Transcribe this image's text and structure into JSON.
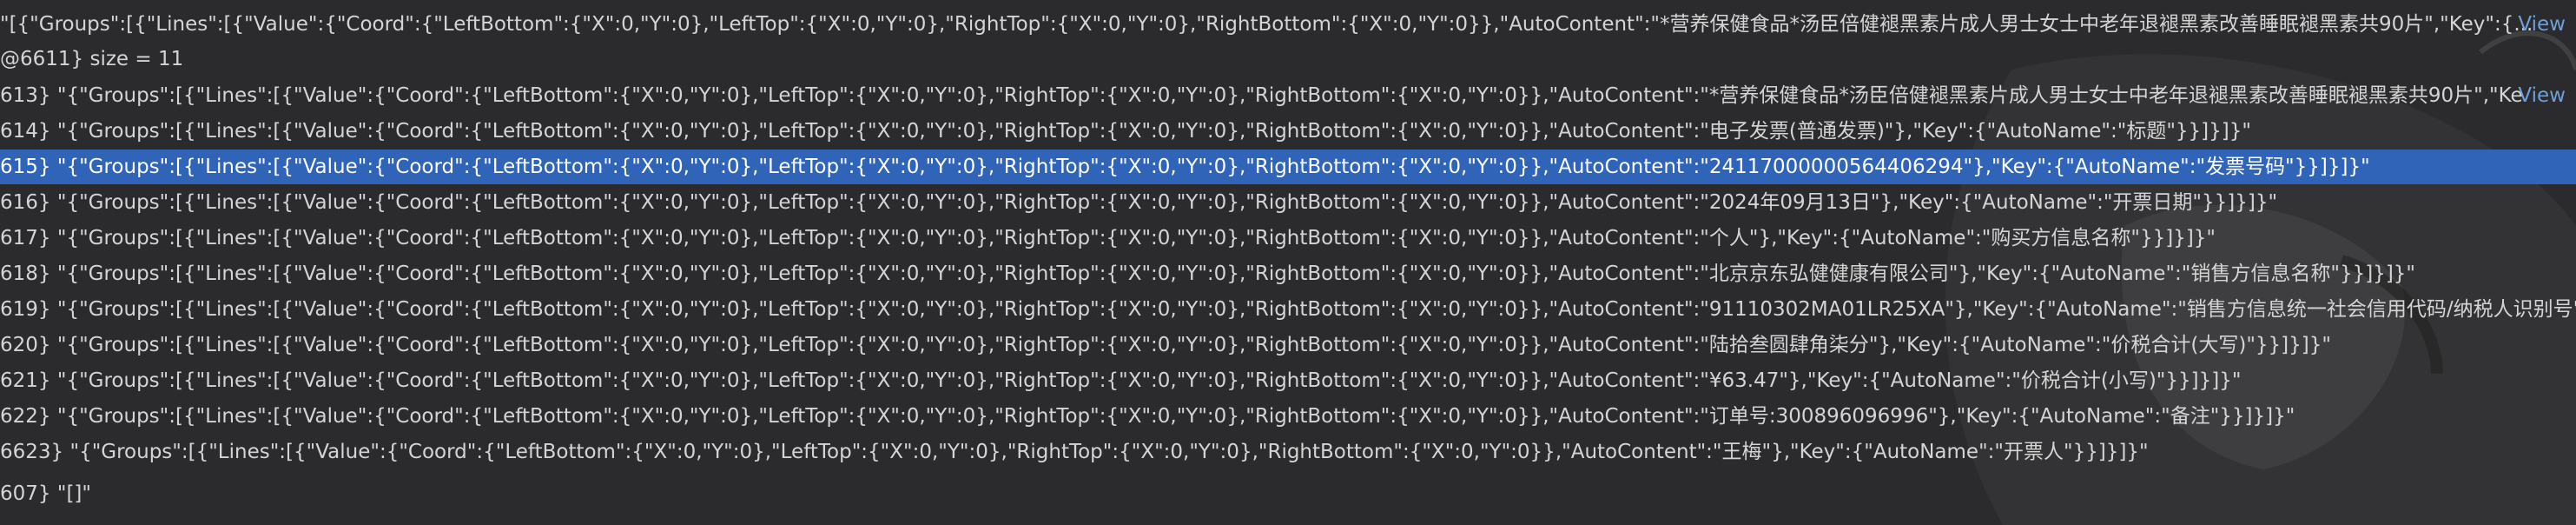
{
  "header_line": {
    "text": "\"[{\"Groups\":[{\"Lines\":[{\"Value\":{\"Coord\":{\"LeftBottom\":{\"X\":0,\"Y\":0},\"LeftTop\":{\"X\":0,\"Y\":0},\"RightTop\":{\"X\":0,\"Y\":0},\"RightBottom\":{\"X\":0,\"Y\":0}},\"AutoContent\":\"*营养保健食品*汤臣倍健褪黑素片成人男士女士中老年退褪黑素改善睡眠褪黑素共90片\",\"Key\":{...",
    "view_label": "View"
  },
  "size_line": "@6611}  size = 11",
  "rows": [
    {
      "id": "613}",
      "value": "\"{\"Groups\":[{\"Lines\":[{\"Value\":{\"Coord\":{\"LeftBottom\":{\"X\":0,\"Y\":0},\"LeftTop\":{\"X\":0,\"Y\":0},\"RightTop\":{\"X\":0,\"Y\":0},\"RightBottom\":{\"X\":0,\"Y\":0}},\"AutoContent\":\"*营养保健食品*汤臣倍健褪黑素片成人男士女士中老年退褪黑素改善睡眠褪黑素共90片\",\"Ke",
      "view": "View"
    },
    {
      "id": "614}",
      "value": "\"{\"Groups\":[{\"Lines\":[{\"Value\":{\"Coord\":{\"LeftBottom\":{\"X\":0,\"Y\":0},\"LeftTop\":{\"X\":0,\"Y\":0},\"RightTop\":{\"X\":0,\"Y\":0},\"RightBottom\":{\"X\":0,\"Y\":0}},\"AutoContent\":\"电子发票(普通发票)\"},\"Key\":{\"AutoName\":\"标题\"}}]}]}\"",
      "view": ""
    },
    {
      "id": "615}",
      "value": "\"{\"Groups\":[{\"Lines\":[{\"Value\":{\"Coord\":{\"LeftBottom\":{\"X\":0,\"Y\":0},\"LeftTop\":{\"X\":0,\"Y\":0},\"RightTop\":{\"X\":0,\"Y\":0},\"RightBottom\":{\"X\":0,\"Y\":0}},\"AutoContent\":\"24117000000564406294\"},\"Key\":{\"AutoName\":\"发票号码\"}}]}]}\"",
      "view": "",
      "selected": true
    },
    {
      "id": "616}",
      "value": "\"{\"Groups\":[{\"Lines\":[{\"Value\":{\"Coord\":{\"LeftBottom\":{\"X\":0,\"Y\":0},\"LeftTop\":{\"X\":0,\"Y\":0},\"RightTop\":{\"X\":0,\"Y\":0},\"RightBottom\":{\"X\":0,\"Y\":0}},\"AutoContent\":\"2024年09月13日\"},\"Key\":{\"AutoName\":\"开票日期\"}}]}]}\"",
      "view": ""
    },
    {
      "id": "617}",
      "value": "\"{\"Groups\":[{\"Lines\":[{\"Value\":{\"Coord\":{\"LeftBottom\":{\"X\":0,\"Y\":0},\"LeftTop\":{\"X\":0,\"Y\":0},\"RightTop\":{\"X\":0,\"Y\":0},\"RightBottom\":{\"X\":0,\"Y\":0}},\"AutoContent\":\"个人\"},\"Key\":{\"AutoName\":\"购买方信息名称\"}}]}]}\"",
      "view": ""
    },
    {
      "id": "618}",
      "value": "\"{\"Groups\":[{\"Lines\":[{\"Value\":{\"Coord\":{\"LeftBottom\":{\"X\":0,\"Y\":0},\"LeftTop\":{\"X\":0,\"Y\":0},\"RightTop\":{\"X\":0,\"Y\":0},\"RightBottom\":{\"X\":0,\"Y\":0}},\"AutoContent\":\"北京京东弘健健康有限公司\"},\"Key\":{\"AutoName\":\"销售方信息名称\"}}]}]}\"",
      "view": ""
    },
    {
      "id": "619}",
      "value": "\"{\"Groups\":[{\"Lines\":[{\"Value\":{\"Coord\":{\"LeftBottom\":{\"X\":0,\"Y\":0},\"LeftTop\":{\"X\":0,\"Y\":0},\"RightTop\":{\"X\":0,\"Y\":0},\"RightBottom\":{\"X\":0,\"Y\":0}},\"AutoContent\":\"91110302MA01LR25XA\"},\"Key\":{\"AutoName\":\"销售方信息统一社会信用代码/纳税人识别号\"}}]}]}\"",
      "view": ""
    },
    {
      "id": "620}",
      "value": "\"{\"Groups\":[{\"Lines\":[{\"Value\":{\"Coord\":{\"LeftBottom\":{\"X\":0,\"Y\":0},\"LeftTop\":{\"X\":0,\"Y\":0},\"RightTop\":{\"X\":0,\"Y\":0},\"RightBottom\":{\"X\":0,\"Y\":0}},\"AutoContent\":\"陆拾叁圆肆角柒分\"},\"Key\":{\"AutoName\":\"价税合计(大写)\"}}]}]}\"",
      "view": ""
    },
    {
      "id": "621}",
      "value": "\"{\"Groups\":[{\"Lines\":[{\"Value\":{\"Coord\":{\"LeftBottom\":{\"X\":0,\"Y\":0},\"LeftTop\":{\"X\":0,\"Y\":0},\"RightTop\":{\"X\":0,\"Y\":0},\"RightBottom\":{\"X\":0,\"Y\":0}},\"AutoContent\":\"¥63.47\"},\"Key\":{\"AutoName\":\"价税合计(小写)\"}}]}]}\"",
      "view": ""
    },
    {
      "id": "622}",
      "value": "\"{\"Groups\":[{\"Lines\":[{\"Value\":{\"Coord\":{\"LeftBottom\":{\"X\":0,\"Y\":0},\"LeftTop\":{\"X\":0,\"Y\":0},\"RightTop\":{\"X\":0,\"Y\":0},\"RightBottom\":{\"X\":0,\"Y\":0}},\"AutoContent\":\"订单号:300896096996\"},\"Key\":{\"AutoName\":\"备注\"}}]}]}\"",
      "view": ""
    },
    {
      "id": "6623}",
      "value": "\"{\"Groups\":[{\"Lines\":[{\"Value\":{\"Coord\":{\"LeftBottom\":{\"X\":0,\"Y\":0},\"LeftTop\":{\"X\":0,\"Y\":0},\"RightTop\":{\"X\":0,\"Y\":0},\"RightBottom\":{\"X\":0,\"Y\":0}},\"AutoContent\":\"王梅\"},\"Key\":{\"AutoName\":\"开票人\"}}]}]}\"",
      "view": ""
    },
    {
      "id": "607}",
      "value": "\"[]\"",
      "view": ""
    }
  ]
}
